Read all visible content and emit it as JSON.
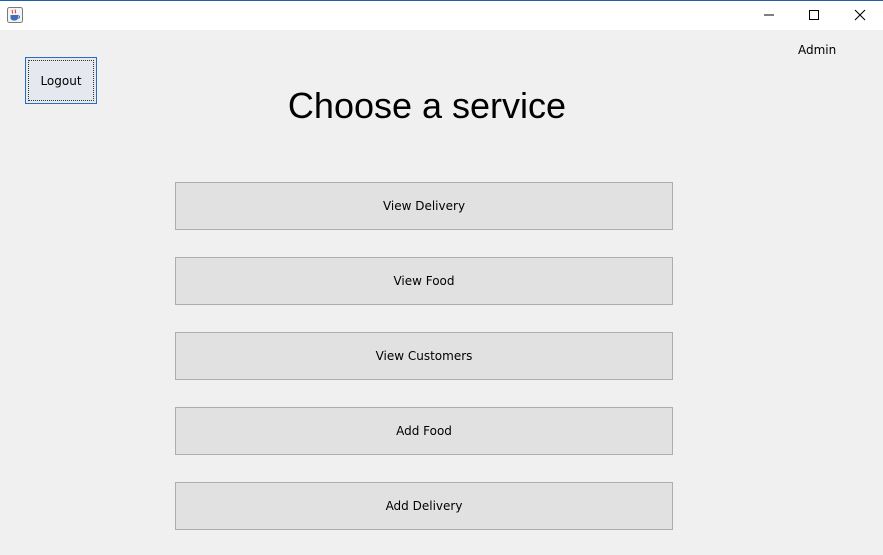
{
  "window": {
    "app_icon": "java-coffee-cup-icon",
    "controls": {
      "minimize_icon": "minimize-icon",
      "maximize_icon": "maximize-icon",
      "close_icon": "close-icon"
    }
  },
  "header": {
    "logout_label": "Logout",
    "user_label": "Admin",
    "title": "Choose a service"
  },
  "services": [
    {
      "label": "View Delivery"
    },
    {
      "label": "View Food"
    },
    {
      "label": "View Customers"
    },
    {
      "label": "Add Food"
    },
    {
      "label": "Add Delivery"
    }
  ],
  "colors": {
    "background": "#f0f0f0",
    "button_face": "#e1e1e1",
    "button_border": "#adadad",
    "focus_border": "#2a6ebb"
  }
}
